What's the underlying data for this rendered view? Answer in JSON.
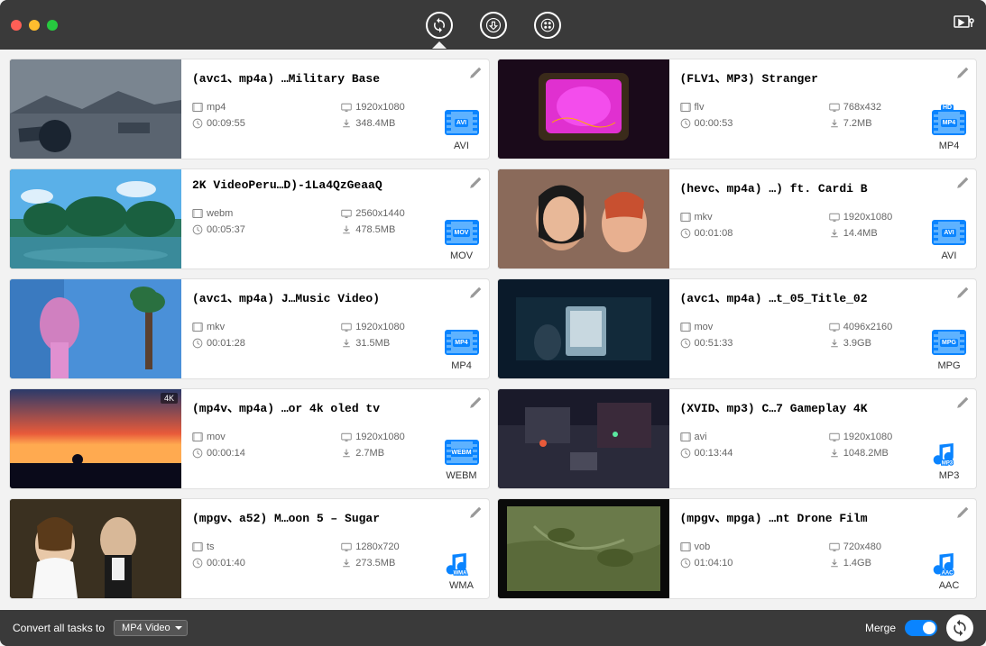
{
  "footer": {
    "convert_label": "Convert all tasks to",
    "select_value": "MP4 Video",
    "merge_label": "Merge",
    "merge_on": true
  },
  "toolbar": {
    "icons": [
      "convert",
      "transfer",
      "media"
    ]
  },
  "items": [
    {
      "title": "(avc1、mp4a) …Military Base",
      "ext": "mp4",
      "resolution": "1920x1080",
      "duration": "00:09:55",
      "size": "348.4MB",
      "format": "AVI",
      "fmt_kind": "video",
      "thumb": "military",
      "thumb_tag": ""
    },
    {
      "title": "(FLV1、MP3) Stranger",
      "ext": "flv",
      "resolution": "768x432",
      "duration": "00:00:53",
      "size": "7.2MB",
      "format": "MP4",
      "fmt_kind": "video_hd",
      "thumb": "crt",
      "thumb_tag": ""
    },
    {
      "title": "2K VideoPeru…D)-1La4QzGeaaQ",
      "ext": "webm",
      "resolution": "2560x1440",
      "duration": "00:05:37",
      "size": "478.5MB",
      "format": "MOV",
      "fmt_kind": "video",
      "thumb": "peru",
      "thumb_tag": ""
    },
    {
      "title": "(hevc、mp4a) …) ft. Cardi B",
      "ext": "mkv",
      "resolution": "1920x1080",
      "duration": "00:01:08",
      "size": "14.4MB",
      "format": "AVI",
      "fmt_kind": "video",
      "thumb": "cardi",
      "thumb_tag": ""
    },
    {
      "title": "(avc1、mp4a) J…Music Video)",
      "ext": "mkv",
      "resolution": "1920x1080",
      "duration": "00:01:28",
      "size": "31.5MB",
      "format": "MP4",
      "fmt_kind": "video",
      "thumb": "music",
      "thumb_tag": ""
    },
    {
      "title": "(avc1、mp4a) …t_05_Title_02",
      "ext": "mov",
      "resolution": "4096x2160",
      "duration": "00:51:33",
      "size": "3.9GB",
      "format": "MPG",
      "fmt_kind": "video",
      "thumb": "tablet",
      "thumb_tag": ""
    },
    {
      "title": "(mp4v、mp4a) …or 4k oled tv",
      "ext": "mov",
      "resolution": "1920x1080",
      "duration": "00:00:14",
      "size": "2.7MB",
      "format": "WEBM",
      "fmt_kind": "video",
      "thumb": "sunset",
      "thumb_tag": "4K"
    },
    {
      "title": "(XVID、mp3) C…7 Gameplay 4K",
      "ext": "avi",
      "resolution": "1920x1080",
      "duration": "00:13:44",
      "size": "1048.2MB",
      "format": "MP3",
      "fmt_kind": "audio",
      "thumb": "game",
      "thumb_tag": ""
    },
    {
      "title": "(mpgv、a52) M…oon 5 – Sugar",
      "ext": "ts",
      "resolution": "1280x720",
      "duration": "00:01:40",
      "size": "273.5MB",
      "format": "WMA",
      "fmt_kind": "audio",
      "thumb": "wedding",
      "thumb_tag": ""
    },
    {
      "title": "(mpgv、mpga) …nt Drone Film",
      "ext": "vob",
      "resolution": "720x480",
      "duration": "01:04:10",
      "size": "1.4GB",
      "format": "AAC",
      "fmt_kind": "audio",
      "thumb": "drone",
      "thumb_tag": ""
    }
  ]
}
